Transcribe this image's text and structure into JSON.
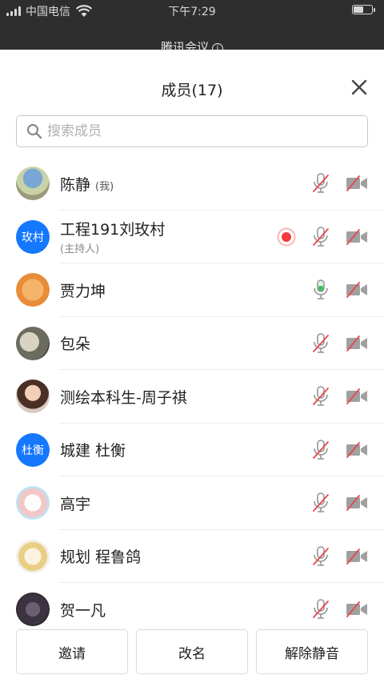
{
  "status_bar": {
    "carrier": "中国电信",
    "time": "下午7:29"
  },
  "app": {
    "title": "腾讯会议"
  },
  "sheet": {
    "title": "成员(17)",
    "search": {
      "placeholder": "搜索成员"
    }
  },
  "members": [
    {
      "name": "陈静",
      "tag": "(我)",
      "sub": "",
      "avatar_text": "",
      "recording": false,
      "mic": "muted",
      "camera": "off"
    },
    {
      "name": "工程191刘玫村",
      "tag": "",
      "sub": "(主持人)",
      "avatar_text": "玫村",
      "recording": true,
      "mic": "muted",
      "camera": "off"
    },
    {
      "name": "贾力坤",
      "tag": "",
      "sub": "",
      "avatar_text": "",
      "recording": false,
      "mic": "active",
      "camera": "off"
    },
    {
      "name": "包朵",
      "tag": "",
      "sub": "",
      "avatar_text": "",
      "recording": false,
      "mic": "muted",
      "camera": "off"
    },
    {
      "name": "测绘本科生-周子祺",
      "tag": "",
      "sub": "",
      "avatar_text": "",
      "recording": false,
      "mic": "muted",
      "camera": "off"
    },
    {
      "name": "城建 杜衡",
      "tag": "",
      "sub": "",
      "avatar_text": "杜衡",
      "recording": false,
      "mic": "muted",
      "camera": "off"
    },
    {
      "name": "高宇",
      "tag": "",
      "sub": "",
      "avatar_text": "",
      "recording": false,
      "mic": "muted",
      "camera": "off"
    },
    {
      "name": "规划 程鲁鸽",
      "tag": "",
      "sub": "",
      "avatar_text": "",
      "recording": false,
      "mic": "muted",
      "camera": "off"
    },
    {
      "name": "贺一凡",
      "tag": "",
      "sub": "",
      "avatar_text": "",
      "recording": false,
      "mic": "muted",
      "camera": "off"
    }
  ],
  "actions": {
    "invite": "邀请",
    "rename": "改名",
    "unmute": "解除静音"
  },
  "colors": {
    "accent_blue": "#1677ff",
    "record_red": "#f23b3b",
    "mic_active_green": "#34c759",
    "muted_red": "#e5484d",
    "icon_gray": "#a0a0a0"
  }
}
